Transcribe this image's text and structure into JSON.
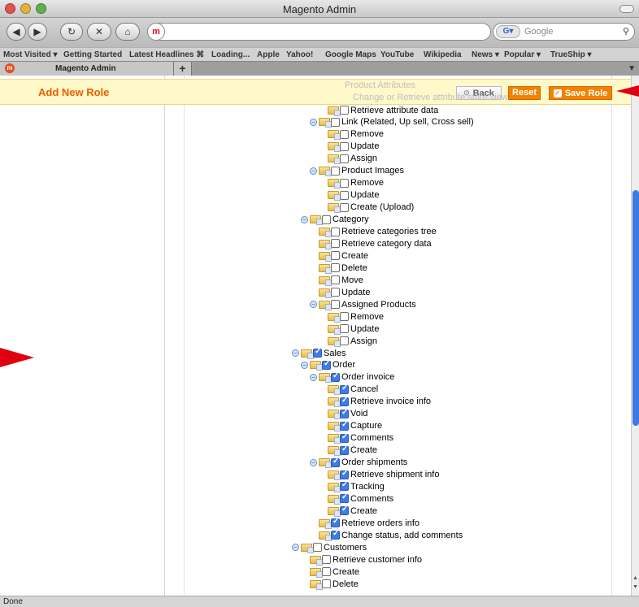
{
  "window": {
    "title": "Magento Admin"
  },
  "search": {
    "placeholder": "Google"
  },
  "bookmarks": [
    "Most Visited ▾",
    "Getting Started",
    "Latest Headlines ⌘",
    "Loading...",
    "Apple",
    "Yahoo!",
    "Google Maps",
    "YouTube",
    "Wikipedia",
    "News ▾",
    "Popular ▾",
    "TrueShip ▾"
  ],
  "tab": {
    "label": "Magento Admin",
    "new_tab": "+"
  },
  "header": {
    "title": "Add New Role",
    "back": "Back",
    "reset": "Reset",
    "save": "Save Role"
  },
  "faded_items": [
    "Product Attributes",
    "Change or Retrieve attribute store view"
  ],
  "tree": [
    {
      "label": "Retrieve attribute data",
      "level": 3,
      "expander": false,
      "checked": false
    },
    {
      "label": "Link (Related, Up sell, Cross sell)",
      "level": 2,
      "expander": true,
      "checked": false
    },
    {
      "label": "Remove",
      "level": 3,
      "expander": false,
      "checked": false
    },
    {
      "label": "Update",
      "level": 3,
      "expander": false,
      "checked": false
    },
    {
      "label": "Assign",
      "level": 3,
      "expander": false,
      "checked": false
    },
    {
      "label": "Product Images",
      "level": 2,
      "expander": true,
      "checked": false
    },
    {
      "label": "Remove",
      "level": 3,
      "expander": false,
      "checked": false
    },
    {
      "label": "Update",
      "level": 3,
      "expander": false,
      "checked": false
    },
    {
      "label": "Create (Upload)",
      "level": 3,
      "expander": false,
      "checked": false
    },
    {
      "label": "Category",
      "level": 1,
      "expander": true,
      "checked": false
    },
    {
      "label": "Retrieve categories tree",
      "level": 2,
      "expander": false,
      "checked": false
    },
    {
      "label": "Retrieve category data",
      "level": 2,
      "expander": false,
      "checked": false
    },
    {
      "label": "Create",
      "level": 2,
      "expander": false,
      "checked": false
    },
    {
      "label": "Delete",
      "level": 2,
      "expander": false,
      "checked": false
    },
    {
      "label": "Move",
      "level": 2,
      "expander": false,
      "checked": false
    },
    {
      "label": "Update",
      "level": 2,
      "expander": false,
      "checked": false
    },
    {
      "label": "Assigned Products",
      "level": 2,
      "expander": true,
      "checked": false
    },
    {
      "label": "Remove",
      "level": 3,
      "expander": false,
      "checked": false
    },
    {
      "label": "Update",
      "level": 3,
      "expander": false,
      "checked": false
    },
    {
      "label": "Assign",
      "level": 3,
      "expander": false,
      "checked": false
    },
    {
      "label": "Sales",
      "level": 0,
      "expander": true,
      "checked": true
    },
    {
      "label": "Order",
      "level": 1,
      "expander": true,
      "checked": true
    },
    {
      "label": "Order invoice",
      "level": 2,
      "expander": true,
      "checked": true
    },
    {
      "label": "Cancel",
      "level": 3,
      "expander": false,
      "checked": true
    },
    {
      "label": "Retrieve invoice info",
      "level": 3,
      "expander": false,
      "checked": true
    },
    {
      "label": "Void",
      "level": 3,
      "expander": false,
      "checked": true
    },
    {
      "label": "Capture",
      "level": 3,
      "expander": false,
      "checked": true
    },
    {
      "label": "Comments",
      "level": 3,
      "expander": false,
      "checked": true
    },
    {
      "label": "Create",
      "level": 3,
      "expander": false,
      "checked": true
    },
    {
      "label": "Order shipments",
      "level": 2,
      "expander": true,
      "checked": true
    },
    {
      "label": "Retrieve shipment info",
      "level": 3,
      "expander": false,
      "checked": true
    },
    {
      "label": "Tracking",
      "level": 3,
      "expander": false,
      "checked": true
    },
    {
      "label": "Comments",
      "level": 3,
      "expander": false,
      "checked": true
    },
    {
      "label": "Create",
      "level": 3,
      "expander": false,
      "checked": true
    },
    {
      "label": "Retrieve orders info",
      "level": 2,
      "expander": false,
      "checked": true
    },
    {
      "label": "Change status, add comments",
      "level": 2,
      "expander": false,
      "checked": true
    },
    {
      "label": "Customers",
      "level": 0,
      "expander": true,
      "checked": false
    },
    {
      "label": "Retrieve customer info",
      "level": 1,
      "expander": false,
      "checked": false
    },
    {
      "label": "Create",
      "level": 1,
      "expander": false,
      "checked": false
    },
    {
      "label": "Delete",
      "level": 1,
      "expander": false,
      "checked": false
    }
  ],
  "status": {
    "text": "Done"
  },
  "colors": {
    "accent": "#f18200",
    "header_bg": "#fff8c8",
    "title": "#eb5e00",
    "checked": "#3f7be0",
    "annotation": "#e0000f"
  }
}
